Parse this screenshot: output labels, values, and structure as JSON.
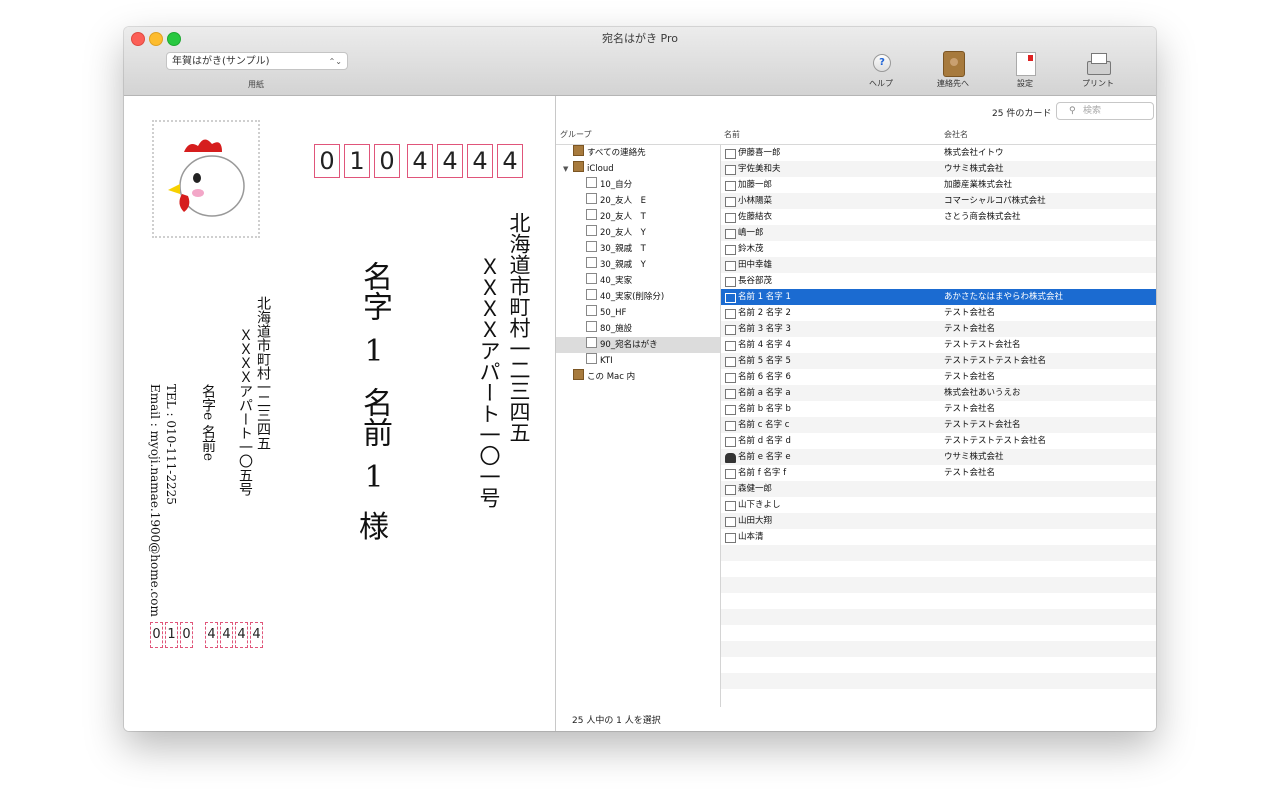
{
  "window": {
    "title": "宛名はがき Pro"
  },
  "toolbar": {
    "paper_select": "年賀はがき(サンプル)",
    "paper_caption": "用紙",
    "buttons": [
      {
        "label": "ヘルプ",
        "icon": "help-icon"
      },
      {
        "label": "連絡先へ",
        "icon": "address-book-icon"
      },
      {
        "label": "設定",
        "icon": "settings-card-icon"
      },
      {
        "label": "プリント",
        "icon": "printer-icon"
      }
    ]
  },
  "postcard": {
    "recipient_zip": [
      "0",
      "1",
      "0",
      "4",
      "4",
      "4",
      "4"
    ],
    "recipient_address1": "北海道市町村一二三四五",
    "recipient_address2": "ＸＸＸＸアパート一〇一号",
    "recipient_name_lines": [
      "名字",
      "1",
      "名前",
      "1",
      "様"
    ],
    "sender_address1": "北海道市町村一二三四五",
    "sender_address2": "ＸＸＸＸアパート一〇五号",
    "sender_name": "名字e 名前e",
    "sender_tel": "TEL : 010-111-2225",
    "sender_email": "Email : myoji.namae.1900@home.com",
    "sender_zip": [
      "0",
      "1",
      "0",
      "4",
      "4",
      "4",
      "4"
    ]
  },
  "list": {
    "count_label": "25 件のカード",
    "search_placeholder": "検索",
    "headers": {
      "group": "グループ",
      "name": "名前",
      "company": "会社名"
    },
    "groups": [
      {
        "label": "すべての連絡先",
        "indent": 0,
        "brown": true
      },
      {
        "label": "iCloud",
        "indent": 0,
        "brown": true,
        "expanded": true
      },
      {
        "label": "10_自分",
        "indent": 1
      },
      {
        "label": "20_友人　E",
        "indent": 1
      },
      {
        "label": "20_友人　T",
        "indent": 1
      },
      {
        "label": "20_友人　Y",
        "indent": 1
      },
      {
        "label": "30_親戚　T",
        "indent": 1
      },
      {
        "label": "30_親戚　Y",
        "indent": 1
      },
      {
        "label": "40_実家",
        "indent": 1
      },
      {
        "label": "40_実家(削除分)",
        "indent": 1
      },
      {
        "label": "50_HF",
        "indent": 1
      },
      {
        "label": "80_施設",
        "indent": 1
      },
      {
        "label": "90_宛名はがき",
        "indent": 1,
        "selected": true
      },
      {
        "label": "KTI",
        "indent": 1
      },
      {
        "label": "この Mac 内",
        "indent": 0,
        "brown": true
      }
    ],
    "contacts": [
      {
        "name": "伊藤喜一郎",
        "company": "株式会社イトウ"
      },
      {
        "name": "宇佐美和夫",
        "company": "ウサミ株式会社"
      },
      {
        "name": "加藤一郎",
        "company": "加藤産業株式会社"
      },
      {
        "name": "小林陽菜",
        "company": "コマーシャルコパ株式会社"
      },
      {
        "name": "佐藤結衣",
        "company": "さとう商会株式会社"
      },
      {
        "name": "嶋一郎",
        "company": ""
      },
      {
        "name": "鈴木茂",
        "company": ""
      },
      {
        "name": "田中幸雄",
        "company": ""
      },
      {
        "name": "長谷部茂",
        "company": ""
      },
      {
        "name": "名前 1 名字 1",
        "company": "あかさたなはまやらわ株式会社",
        "selected": true
      },
      {
        "name": "名前 2 名字 2",
        "company": "テスト会社名"
      },
      {
        "name": "名前 3 名字 3",
        "company": "テスト会社名"
      },
      {
        "name": "名前 4 名字 4",
        "company": "テストテスト会社名"
      },
      {
        "name": "名前 5 名字 5",
        "company": "テストテストテスト会社名"
      },
      {
        "name": "名前 6 名字 6",
        "company": "テスト会社名"
      },
      {
        "name": "名前 a 名字 a",
        "company": "株式会社あいうえお"
      },
      {
        "name": "名前 b 名字 b",
        "company": "テスト会社名"
      },
      {
        "name": "名前 c 名字 c",
        "company": "テストテスト会社名"
      },
      {
        "name": "名前 d 名字 d",
        "company": "テストテストテスト会社名"
      },
      {
        "name": "名前 e 名字 e",
        "company": "ウサミ株式会社",
        "me": true
      },
      {
        "name": "名前 f 名字 f",
        "company": "テスト会社名"
      },
      {
        "name": "森健一郎",
        "company": ""
      },
      {
        "name": "山下きよし",
        "company": ""
      },
      {
        "name": "山田大翔",
        "company": ""
      },
      {
        "name": "山本清",
        "company": ""
      }
    ],
    "status": "25 人中の 1 人を選択"
  }
}
